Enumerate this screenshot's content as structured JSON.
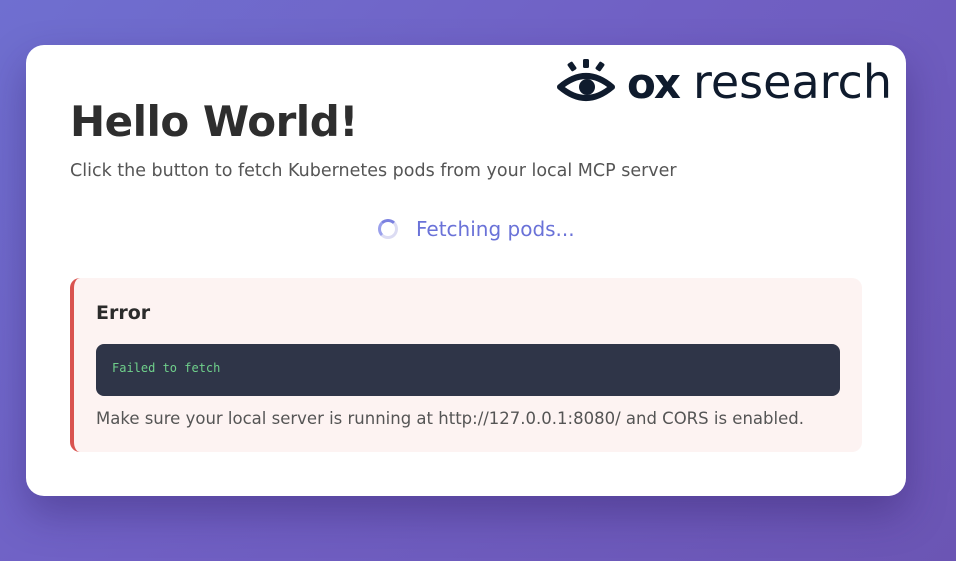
{
  "logo": {
    "brand": "ox",
    "text": "research",
    "icon": "eye-icon"
  },
  "page": {
    "title": "Hello World!",
    "subtitle": "Click the button to fetch Kubernetes pods from your local MCP server"
  },
  "loading": {
    "text": "Fetching pods...",
    "icon": "spinner-icon"
  },
  "error": {
    "title": "Error",
    "message": "Failed to fetch",
    "hint": "Make sure your local server is running at http://127.0.0.1:8080/ and CORS is enabled."
  },
  "colors": {
    "accent": "#6a72d8",
    "error_border": "#d9534f",
    "error_bg": "#fdf3f2",
    "code_bg": "#2f3548",
    "code_text": "#6fd08b",
    "logo": "#0f1b2d"
  }
}
